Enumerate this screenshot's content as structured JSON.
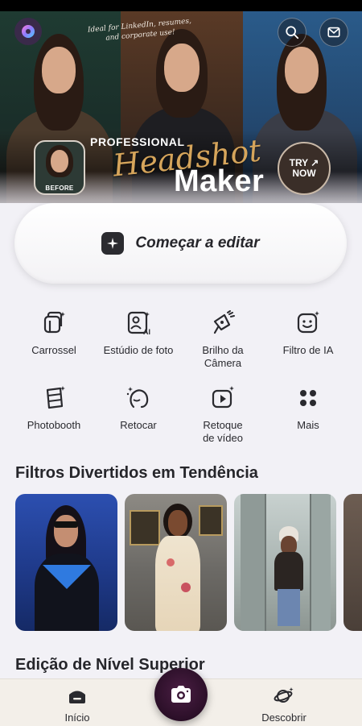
{
  "banner": {
    "note": "Ideal for LinkedIn, resumes, and corporate use!",
    "before_label": "BEFORE",
    "professional": "PROFESSIONAL",
    "headshot": "Headshot",
    "maker": "Maker",
    "try_now": "TRY ↗ NOW"
  },
  "start_button": {
    "label": "Começar a editar"
  },
  "tools": [
    {
      "label": "Carrossel",
      "icon": "carousel-icon"
    },
    {
      "label": "Estúdio de foto",
      "icon": "ai-photo-studio-icon"
    },
    {
      "label": "Brilho da Câmera",
      "icon": "camera-flash-icon"
    },
    {
      "label": "Filtro de IA",
      "icon": "ai-filter-face-icon"
    },
    {
      "label": "Photobooth",
      "icon": "photobooth-icon"
    },
    {
      "label": "Retocar",
      "icon": "retouch-face-icon"
    },
    {
      "label": "Retoque de vídeo",
      "icon": "video-retouch-icon"
    },
    {
      "label": "Mais",
      "icon": "more-grid-icon"
    }
  ],
  "trending": {
    "title": "Filtros Divertidos em Tendência"
  },
  "next_section": {
    "title": "Edição de Nível Superior"
  },
  "nav": {
    "home": "Início",
    "discover": "Descobrir"
  }
}
